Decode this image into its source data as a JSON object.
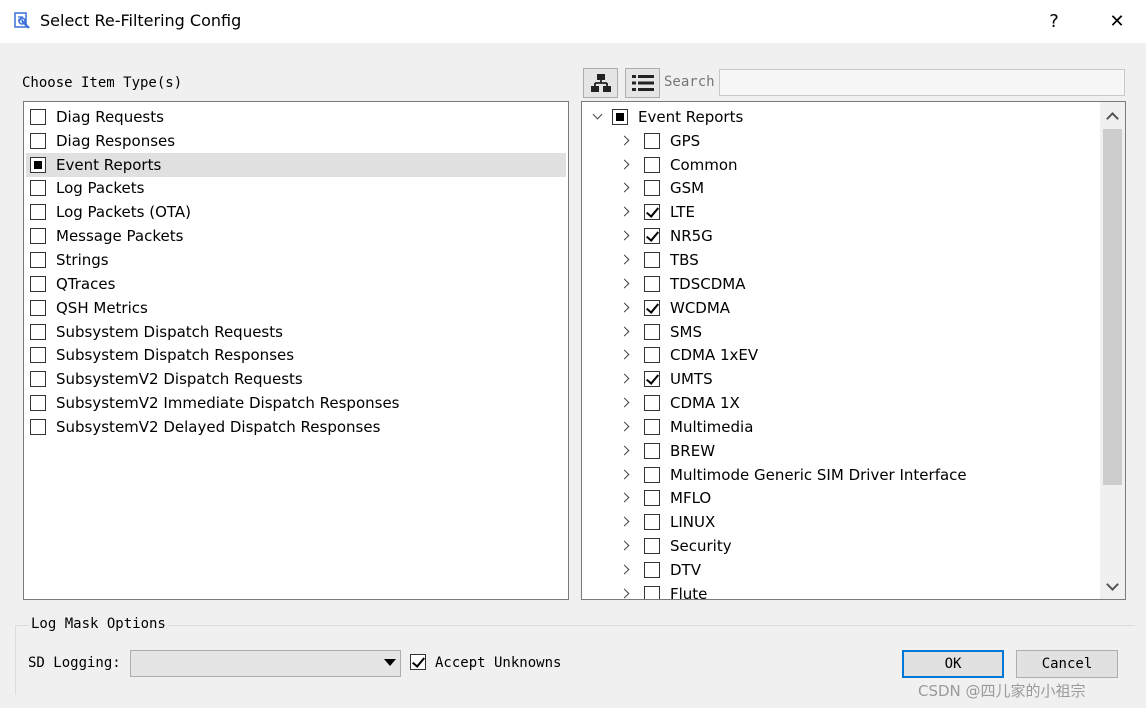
{
  "window": {
    "title": "Select Re-Filtering Config",
    "help": "?",
    "close": "✕"
  },
  "left": {
    "label": "Choose Item Type(s)",
    "items": [
      {
        "label": "Diag Requests",
        "state": "unchecked"
      },
      {
        "label": "Diag Responses",
        "state": "unchecked"
      },
      {
        "label": "Event Reports",
        "state": "partial",
        "selected": true
      },
      {
        "label": "Log Packets",
        "state": "unchecked"
      },
      {
        "label": "Log Packets (OTA)",
        "state": "unchecked"
      },
      {
        "label": "Message Packets",
        "state": "unchecked"
      },
      {
        "label": "Strings",
        "state": "unchecked"
      },
      {
        "label": "QTraces",
        "state": "unchecked"
      },
      {
        "label": "QSH Metrics",
        "state": "unchecked"
      },
      {
        "label": "Subsystem Dispatch Requests",
        "state": "unchecked"
      },
      {
        "label": "Subsystem Dispatch Responses",
        "state": "unchecked"
      },
      {
        "label": "SubsystemV2 Dispatch Requests",
        "state": "unchecked"
      },
      {
        "label": "SubsystemV2 Immediate Dispatch Responses",
        "state": "unchecked"
      },
      {
        "label": "SubsystemV2 Delayed Dispatch Responses",
        "state": "unchecked"
      }
    ]
  },
  "right": {
    "search_label": "Search",
    "search_value": "",
    "root": {
      "label": "Event Reports",
      "state": "partial",
      "expanded": true
    },
    "children": [
      {
        "label": "GPS",
        "checked": false
      },
      {
        "label": "Common",
        "checked": false
      },
      {
        "label": "GSM",
        "checked": false
      },
      {
        "label": "LTE",
        "checked": true
      },
      {
        "label": "NR5G",
        "checked": true
      },
      {
        "label": "TBS",
        "checked": false
      },
      {
        "label": "TDSCDMA",
        "checked": false
      },
      {
        "label": "WCDMA",
        "checked": true
      },
      {
        "label": "SMS",
        "checked": false
      },
      {
        "label": "CDMA 1xEV",
        "checked": false
      },
      {
        "label": "UMTS",
        "checked": true
      },
      {
        "label": "CDMA 1X",
        "checked": false
      },
      {
        "label": "Multimedia",
        "checked": false
      },
      {
        "label": "BREW",
        "checked": false
      },
      {
        "label": "Multimode Generic SIM Driver Interface",
        "checked": false
      },
      {
        "label": "MFLO",
        "checked": false
      },
      {
        "label": "LINUX",
        "checked": false
      },
      {
        "label": "Security",
        "checked": false
      },
      {
        "label": "DTV",
        "checked": false
      },
      {
        "label": "Flute",
        "checked": false
      }
    ]
  },
  "log_mask": {
    "group_label": "Log Mask Options",
    "sd_label": "SD Logging:",
    "sd_value": "",
    "accept_unknowns_label": "Accept Unknowns",
    "accept_unknowns_checked": true
  },
  "buttons": {
    "ok": "OK",
    "cancel": "Cancel"
  },
  "watermark": "CSDN @四儿家的小祖宗",
  "colors": {
    "focus_border": "#0078d7",
    "selected_row": "#e0e0e0"
  }
}
